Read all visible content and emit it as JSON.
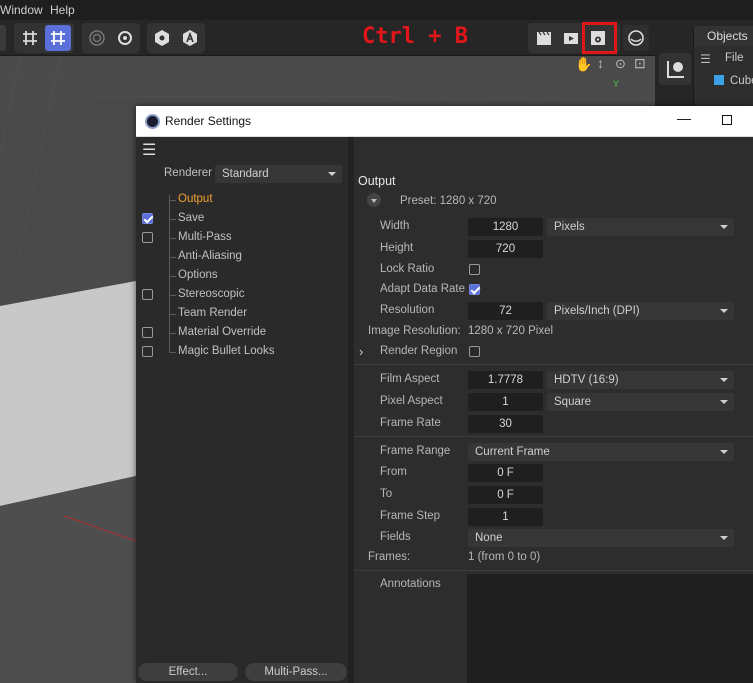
{
  "menubar": {
    "items": [
      "Window",
      "Help"
    ]
  },
  "overlay_hint": "Ctrl + B",
  "objects_panel": {
    "tab": "Objects",
    "menu_file": "File",
    "item": "Cube"
  },
  "viewport": {
    "axis_y": "Y"
  },
  "render_settings": {
    "title": "Render Settings",
    "renderer_label": "Renderer",
    "renderer_value": "Standard",
    "nav": [
      {
        "label": "Output",
        "checkbox": null,
        "active": true
      },
      {
        "label": "Save",
        "checkbox": true
      },
      {
        "label": "Multi-Pass",
        "checkbox": false
      },
      {
        "label": "Anti-Aliasing",
        "checkbox": null
      },
      {
        "label": "Options",
        "checkbox": null
      },
      {
        "label": "Stereoscopic",
        "checkbox": false
      },
      {
        "label": "Team Render",
        "checkbox": null
      },
      {
        "label": "Material Override",
        "checkbox": false
      },
      {
        "label": "Magic Bullet Looks",
        "checkbox": false
      }
    ],
    "effect_button": "Effect...",
    "multipass_button": "Multi-Pass...",
    "output": {
      "heading": "Output",
      "preset": "Preset: 1280 x 720",
      "width_label": "Width",
      "width_value": "1280",
      "width_unit": "Pixels",
      "height_label": "Height",
      "height_value": "720",
      "lock_ratio_label": "Lock Ratio",
      "lock_ratio": false,
      "adapt_label": "Adapt Data Rate",
      "adapt": true,
      "resolution_label": "Resolution",
      "resolution_value": "72",
      "resolution_unit": "Pixels/Inch (DPI)",
      "image_res_label": "Image Resolution:",
      "image_res_value": "1280 x 720 Pixel",
      "render_region_label": "Render Region",
      "render_region": false,
      "film_aspect_label": "Film Aspect",
      "film_aspect_value": "1.7778",
      "film_aspect_preset": "HDTV (16:9)",
      "pixel_aspect_label": "Pixel Aspect",
      "pixel_aspect_value": "1",
      "pixel_aspect_preset": "Square",
      "frame_rate_label": "Frame Rate",
      "frame_rate_value": "30",
      "frame_range_label": "Frame Range",
      "frame_range_value": "Current Frame",
      "from_label": "From",
      "from_value": "0 F",
      "to_label": "To",
      "to_value": "0 F",
      "frame_step_label": "Frame Step",
      "frame_step_value": "1",
      "fields_label": "Fields",
      "fields_value": "None",
      "frames_label": "Frames:",
      "frames_value": "1 (from 0 to 0)",
      "annotations_label": "Annotations"
    }
  },
  "colors": {
    "highlight_box": "#e0161b",
    "accent": "#5a6fd8",
    "active_nav": "#f0a030"
  }
}
